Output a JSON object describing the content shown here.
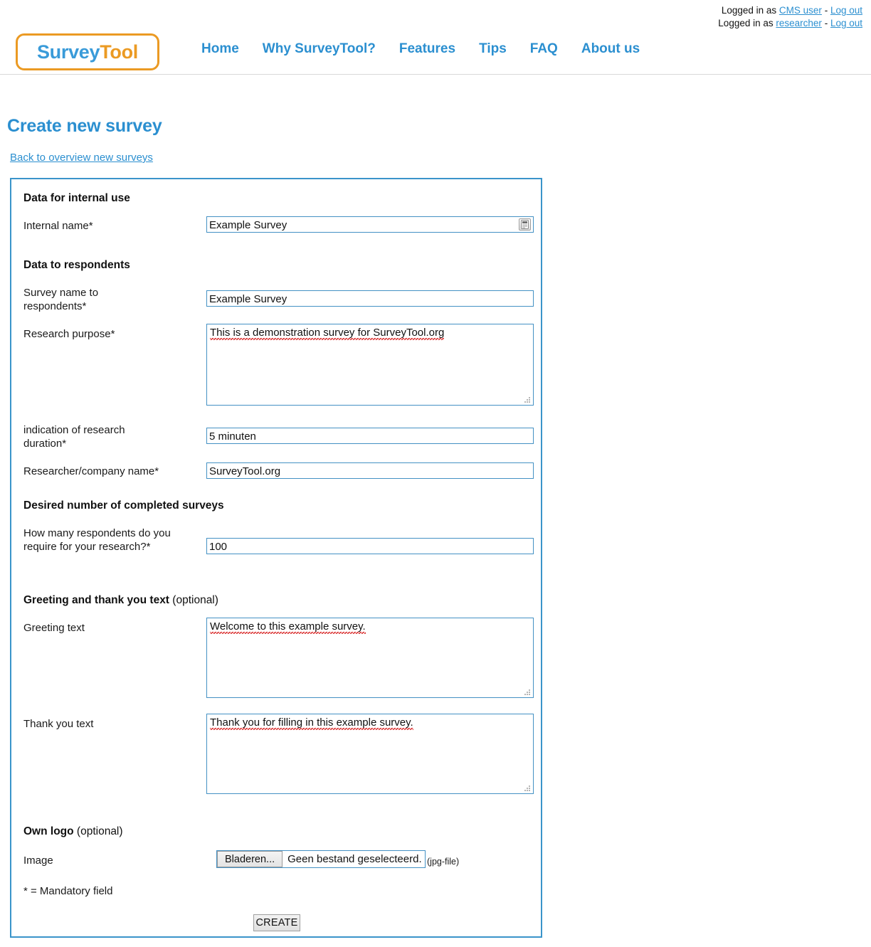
{
  "account_bar": {
    "rows": [
      {
        "prefix": "Logged in as",
        "user": "CMS user",
        "sep": "-",
        "logout": "Log out"
      },
      {
        "prefix": "Logged in as",
        "user": "researcher",
        "sep": "-",
        "logout": "Log out"
      }
    ]
  },
  "brand": {
    "name_part1": "Survey",
    "name_part2": "Tool",
    "color_blue": "#3a9bd9",
    "color_orange": "#eb9a23"
  },
  "nav": {
    "items": [
      {
        "label": "Home"
      },
      {
        "label": "Why SurveyTool?"
      },
      {
        "label": "Features"
      },
      {
        "label": "Tips"
      },
      {
        "label": "FAQ"
      },
      {
        "label": "About us"
      }
    ]
  },
  "page": {
    "title": "Create new survey",
    "back_link": "Back to overview new surveys",
    "accent_color": "#2b8fd0"
  },
  "form": {
    "sections": {
      "internal": {
        "heading": "Data for internal use"
      },
      "respondents": {
        "heading": "Data to respondents"
      },
      "desired": {
        "heading": "Desired number of completed surveys"
      },
      "greeting": {
        "heading": "Greeting and thank you text",
        "optional": "(optional)"
      },
      "logo": {
        "heading": "Own logo",
        "optional": "(optional)"
      }
    },
    "fields": {
      "internal_name": {
        "label": "Internal name*",
        "value": "Example Survey",
        "placeholder": ""
      },
      "survey_name": {
        "label": "Survey name to respondents*",
        "value": "Example Survey",
        "placeholder": ""
      },
      "research_purpose": {
        "label": "Research purpose*",
        "value": "This is a demonstration survey for SurveyTool.org",
        "placeholder": ""
      },
      "duration": {
        "label": "indication of research duration*",
        "value": "5 minuten",
        "placeholder": ""
      },
      "researcher": {
        "label": "Researcher/company name*",
        "value": "SurveyTool.org",
        "placeholder": ""
      },
      "respondent_count": {
        "label": "How many respondents do you require for your research?*",
        "value": "100",
        "placeholder": ""
      },
      "greeting_text": {
        "label": "Greeting text",
        "value": "Welcome to this example survey.",
        "placeholder": ""
      },
      "thankyou_text": {
        "label": "Thank you text",
        "value": "Thank you for filling in this example survey.",
        "placeholder": ""
      },
      "image": {
        "label": "Image",
        "browse_button": "Bladeren...",
        "file_status": "Geen bestand geselecteerd.",
        "hint": "(jpg-file)"
      }
    },
    "mandatory_note": "* = Mandatory field",
    "submit_label": "CREATE"
  },
  "icons": {
    "autofill": "form-autofill-icon",
    "resize_grip": "resize-grip-icon"
  }
}
